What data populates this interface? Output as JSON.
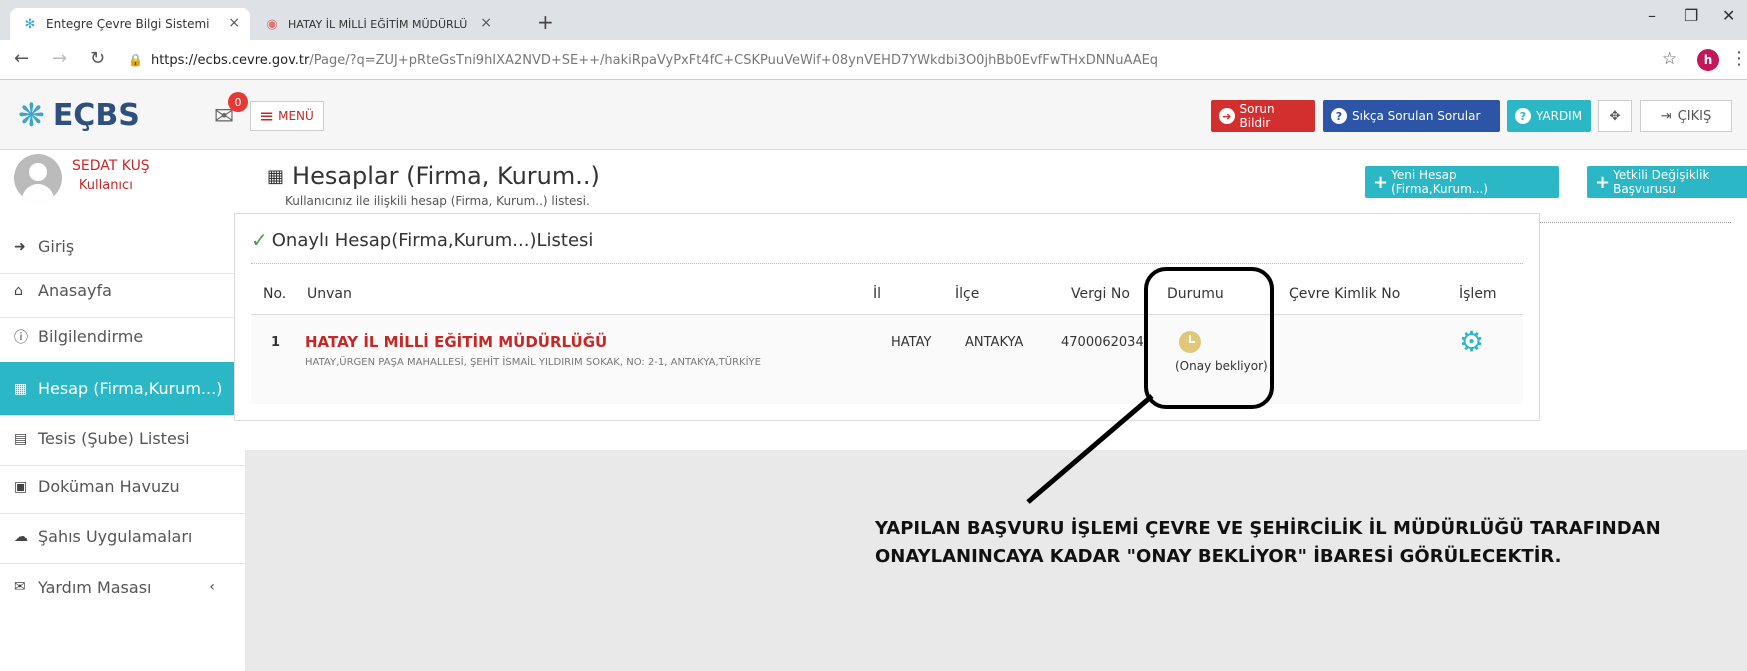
{
  "browser": {
    "tabs": [
      {
        "title": "Entegre Çevre Bilgi Sistemi",
        "close": "×"
      },
      {
        "title": "HATAY İL MİLLİ EĞİTİM MÜDÜRLÜ",
        "close": "×"
      }
    ],
    "new_tab": "+",
    "url_host": "https://ecbs.cevre.gov.tr",
    "url_path": "/Page/?q=ZUJ+pRteGsTni9hIXA2NVD+SE++/hakiRpaVyPxFt4fC+CSKPuuVeWif+08ynVEHD7YWkdbi3O0jhBb0EvfFwTHxDNNuAAEq",
    "profile_initial": "h"
  },
  "header": {
    "logo": "EÇBS",
    "mail_badge": "0",
    "menu_label": "MENÜ",
    "buttons": {
      "report": "Sorun Bildir",
      "faq": "Sıkça Sorulan Sorular",
      "help": "YARDIM",
      "logout": "ÇIKIŞ"
    }
  },
  "sidebar": {
    "user_name": "SEDAT KUŞ",
    "user_role": "Kullanıcı",
    "items": [
      {
        "label": "Giriş"
      },
      {
        "label": "Anasayfa"
      },
      {
        "label": "Bilgilendirme"
      },
      {
        "label": "Hesap (Firma,Kurum...)"
      },
      {
        "label": "Tesis (Şube) Listesi"
      },
      {
        "label": "Doküman Havuzu"
      },
      {
        "label": "Şahıs Uygulamaları"
      },
      {
        "label": "Yardım Masası"
      }
    ]
  },
  "page": {
    "title": "Hesaplar (Firma, Kurum..)",
    "subtitle": "Kullanıcınız ile ilişkili hesap (Firma, Kurum..) listesi.",
    "new_account_button": "Yeni Hesap (Firma,Kurum...)",
    "authority_change_button": "Yetkili Değişiklik Başvurusu"
  },
  "panel": {
    "title": "Onaylı Hesap(Firma,Kurum...)Listesi",
    "columns": [
      "No.",
      "Unvan",
      "İl",
      "İlçe",
      "Vergi No",
      "Durumu",
      "Çevre Kimlik No",
      "İşlem"
    ],
    "rows": [
      {
        "no": "1",
        "name": "HATAY İL MİLLİ EĞİTİM MÜDÜRLÜĞÜ",
        "address": "HATAY,ÜRGEN PAŞA MAHALLESİ, ŞEHİT İSMAİL YILDIRIM SOKAK, NO: 2-1, ANTAKYA,TÜRKİYE",
        "il": "HATAY",
        "ilce": "ANTAKYA",
        "vergi_no": "4700062034",
        "status": "(Onay bekliyor)",
        "cevre_kimlik_no": ""
      }
    ]
  },
  "annotation": {
    "line1": "YAPILAN BAŞVURU İŞLEMİ ÇEVRE VE ŞEHİRCİLİK İL MÜDÜRLÜĞÜ TARAFINDAN",
    "line2": "ONAYLANINCAYA KADAR \"ONAY BEKLİYOR\" İBARESİ GÖRÜLECEKTİR."
  }
}
